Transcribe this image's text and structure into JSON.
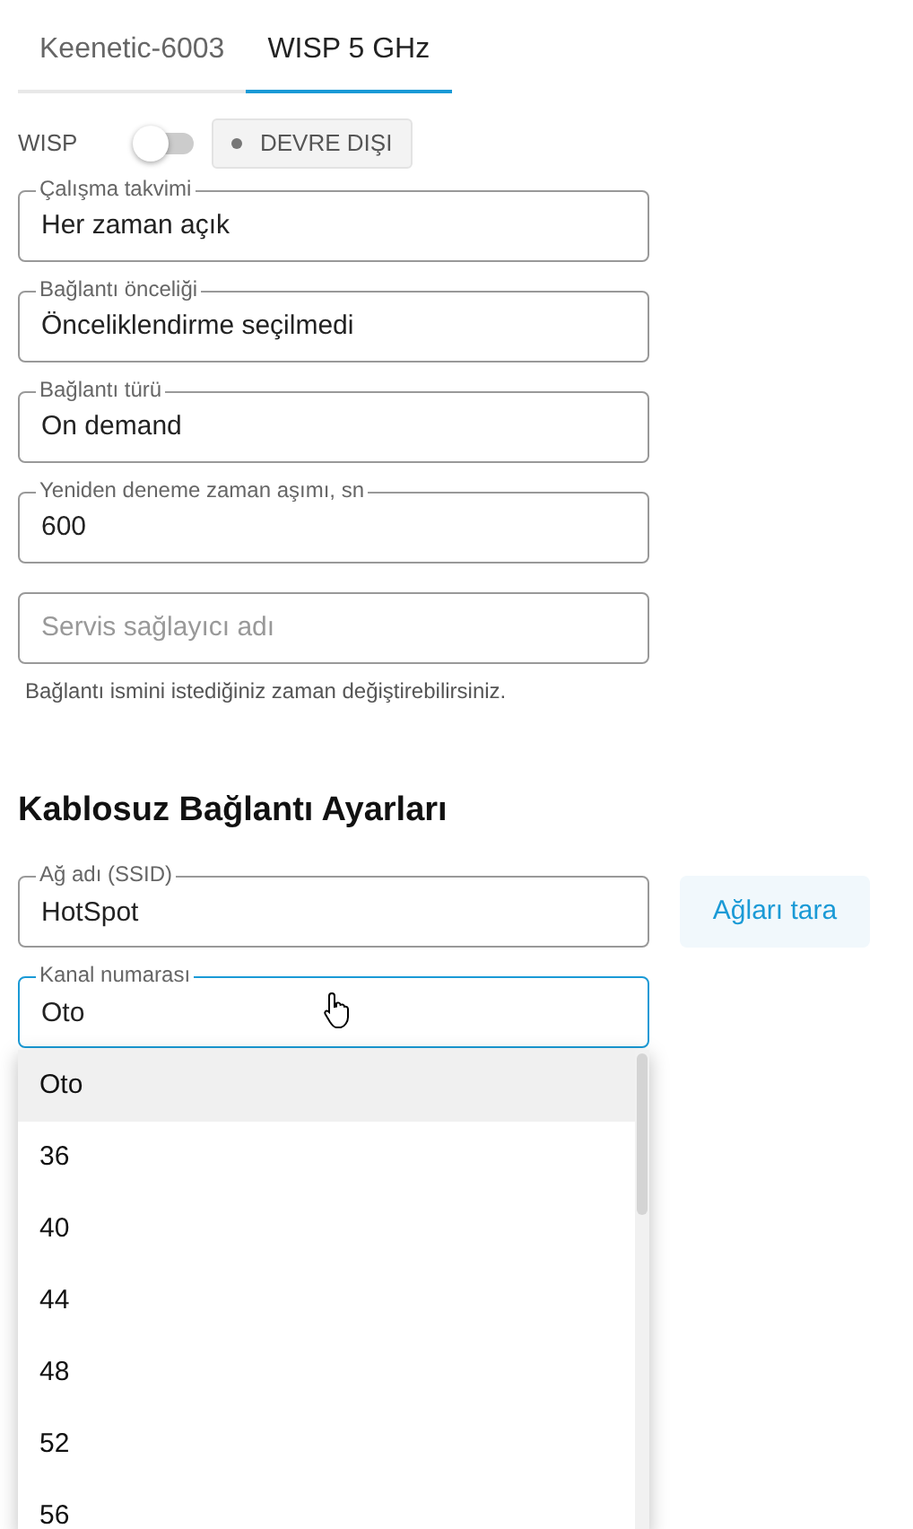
{
  "tabs": [
    {
      "label": "Keenetic-6003",
      "selected": false
    },
    {
      "label": "WISP 5 GHz",
      "selected": true
    }
  ],
  "wisp": {
    "label": "WISP",
    "on": false,
    "status": "DEVRE DIŞI"
  },
  "fields": [
    {
      "label": "Çalışma takvimi",
      "value": "Her zaman açık"
    },
    {
      "label": "Bağlantı önceliği",
      "value": "Önceliklendirme seçilmedi"
    },
    {
      "label": "Bağlantı türü",
      "value": "On demand"
    },
    {
      "label": "Yeniden deneme zaman aşımı, sn",
      "value": "600"
    },
    {
      "placeholder": "Servis sağlayıcı adı"
    }
  ],
  "hint": "Bağlantı ismini istediğiniz zaman değiştirebilirsiniz.",
  "section_title": "Kablosuz Bağlantı Ayarları",
  "ssid": {
    "label": "Ağ adı (SSID)",
    "value": "HotSpot",
    "button": "Ağları tara"
  },
  "channel": {
    "label": "Kanal numarası",
    "value": "Oto",
    "focused": true,
    "options": [
      {
        "label": "Oto",
        "selected": true
      },
      {
        "label": "36",
        "selected": false
      },
      {
        "label": "40",
        "selected": false
      },
      {
        "label": "44",
        "selected": false
      },
      {
        "label": "48",
        "selected": false
      },
      {
        "label": "52",
        "selected": false
      },
      {
        "label": "56",
        "selected": false
      }
    ]
  }
}
